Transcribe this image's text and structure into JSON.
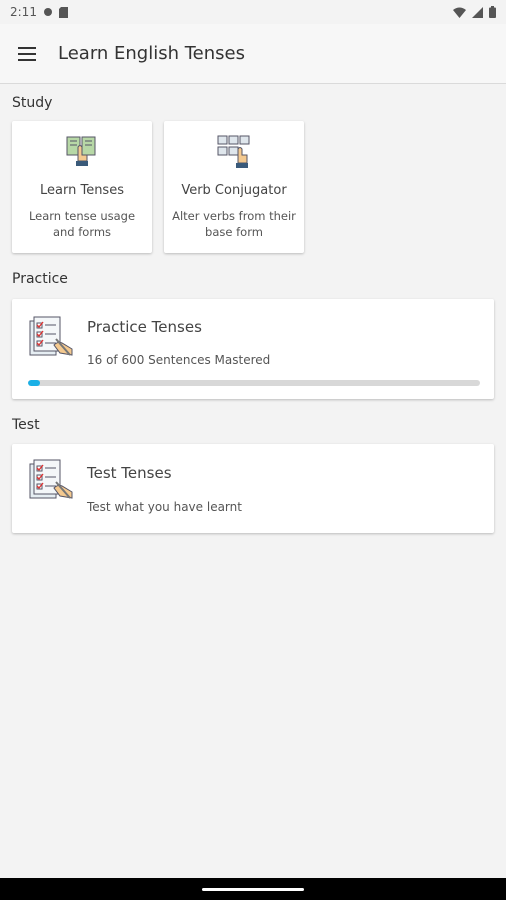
{
  "status_bar": {
    "time": "2:11"
  },
  "app_bar": {
    "title": "Learn English Tenses"
  },
  "sections": {
    "study": "Study",
    "practice": "Practice",
    "test": "Test"
  },
  "study_tiles": [
    {
      "title": "Learn Tenses",
      "subtitle": "Learn tense usage and forms",
      "icon": "book-hand-icon"
    },
    {
      "title": "Verb Conjugator",
      "subtitle": "Alter verbs from their base form",
      "icon": "keyboard-hand-icon"
    }
  ],
  "practice_card": {
    "title": "Practice Tenses",
    "subtitle": "16 of 600 Sentences Mastered",
    "progress": 0.0267,
    "progress_color": "#1ab0e6",
    "icon": "checklist-pencil-icon"
  },
  "test_card": {
    "title": "Test Tenses",
    "subtitle": "Test what you have learnt",
    "icon": "checklist-pencil-icon"
  }
}
